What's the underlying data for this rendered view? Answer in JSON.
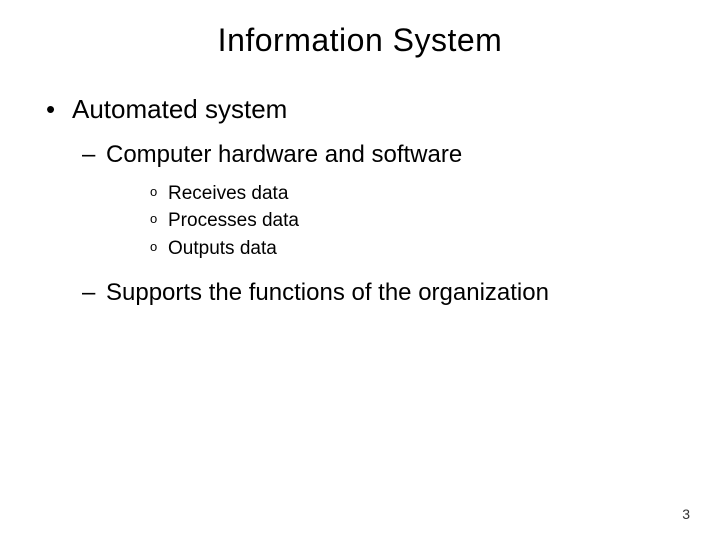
{
  "title": "Information System",
  "bullets": {
    "level1": "Automated system",
    "level2a": "Computer hardware and software",
    "level3": {
      "a": "Receives data",
      "b": "Processes data",
      "c": "Outputs data"
    },
    "level2b": "Supports the functions of the organization"
  },
  "markers": {
    "dot": "•",
    "dash": "–",
    "circle": "o"
  },
  "page": "3"
}
